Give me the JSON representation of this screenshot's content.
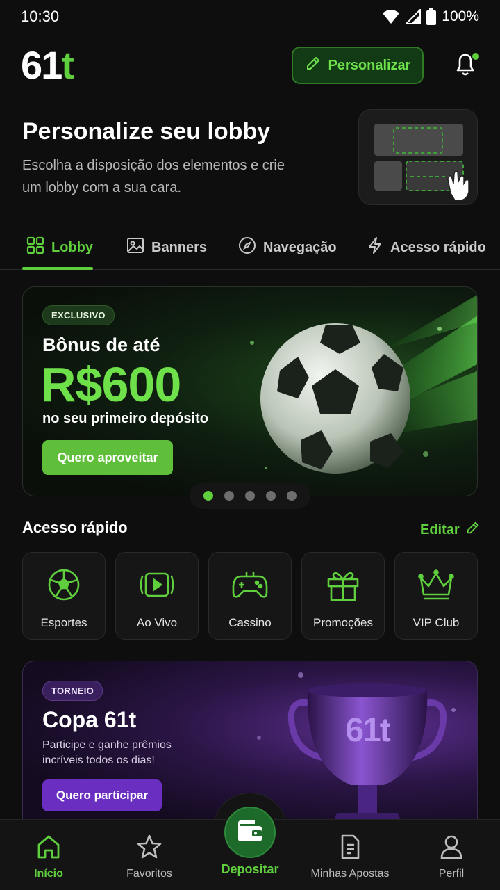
{
  "status_bar": {
    "time": "10:30",
    "battery": "100%"
  },
  "header": {
    "logo_main": "61",
    "logo_accent": "t",
    "personalize_label": "Personalizar",
    "notification_dot": true
  },
  "hero": {
    "title": "Personalize seu lobby",
    "subtitle": "Escolha a disposição dos elementos e crie um lobby com a sua cara."
  },
  "tabs": [
    {
      "label": "Lobby",
      "icon": "grid-icon",
      "active": true
    },
    {
      "label": "Banners",
      "icon": "image-icon",
      "active": false
    },
    {
      "label": "Navegação",
      "icon": "compass-icon",
      "active": false
    },
    {
      "label": "Acesso rápido",
      "icon": "lightning-icon",
      "active": false
    }
  ],
  "banner": {
    "badge": "EXCLUSIVO",
    "line1": "Bônus de até",
    "amount": "R$600",
    "line3": "no seu primeiro depósito",
    "cta": "Quero aproveitar",
    "carousel_total": 5,
    "carousel_active": 1
  },
  "quick_access": {
    "title": "Acesso rápido",
    "edit_label": "Editar",
    "items": [
      {
        "label": "Esportes",
        "icon": "soccer-ball-icon"
      },
      {
        "label": "Ao Vivo",
        "icon": "live-play-icon"
      },
      {
        "label": "Cassino",
        "icon": "gamepad-icon"
      },
      {
        "label": "Promoções",
        "icon": "gift-icon"
      },
      {
        "label": "VIP Club",
        "icon": "crown-icon"
      }
    ]
  },
  "tournament": {
    "badge": "TORNEIO",
    "title": "Copa 61t",
    "subtitle": "Participe e ganhe prêmios incríveis todos os dias!",
    "cta": "Quero participar",
    "trophy_text": "61t"
  },
  "bottom_nav": [
    {
      "label": "Início",
      "icon": "home-icon",
      "active": true
    },
    {
      "label": "Favoritos",
      "icon": "star-icon",
      "active": false
    },
    {
      "label": "Depositar",
      "icon": "wallet-icon",
      "active": false
    },
    {
      "label": "Minhas Apostas",
      "icon": "document-icon",
      "active": false
    },
    {
      "label": "Perfil",
      "icon": "user-icon",
      "active": false
    }
  ],
  "colors": {
    "accent": "#5fcf3d",
    "background": "#0e0e0e",
    "purple": "#6a2fc0"
  }
}
